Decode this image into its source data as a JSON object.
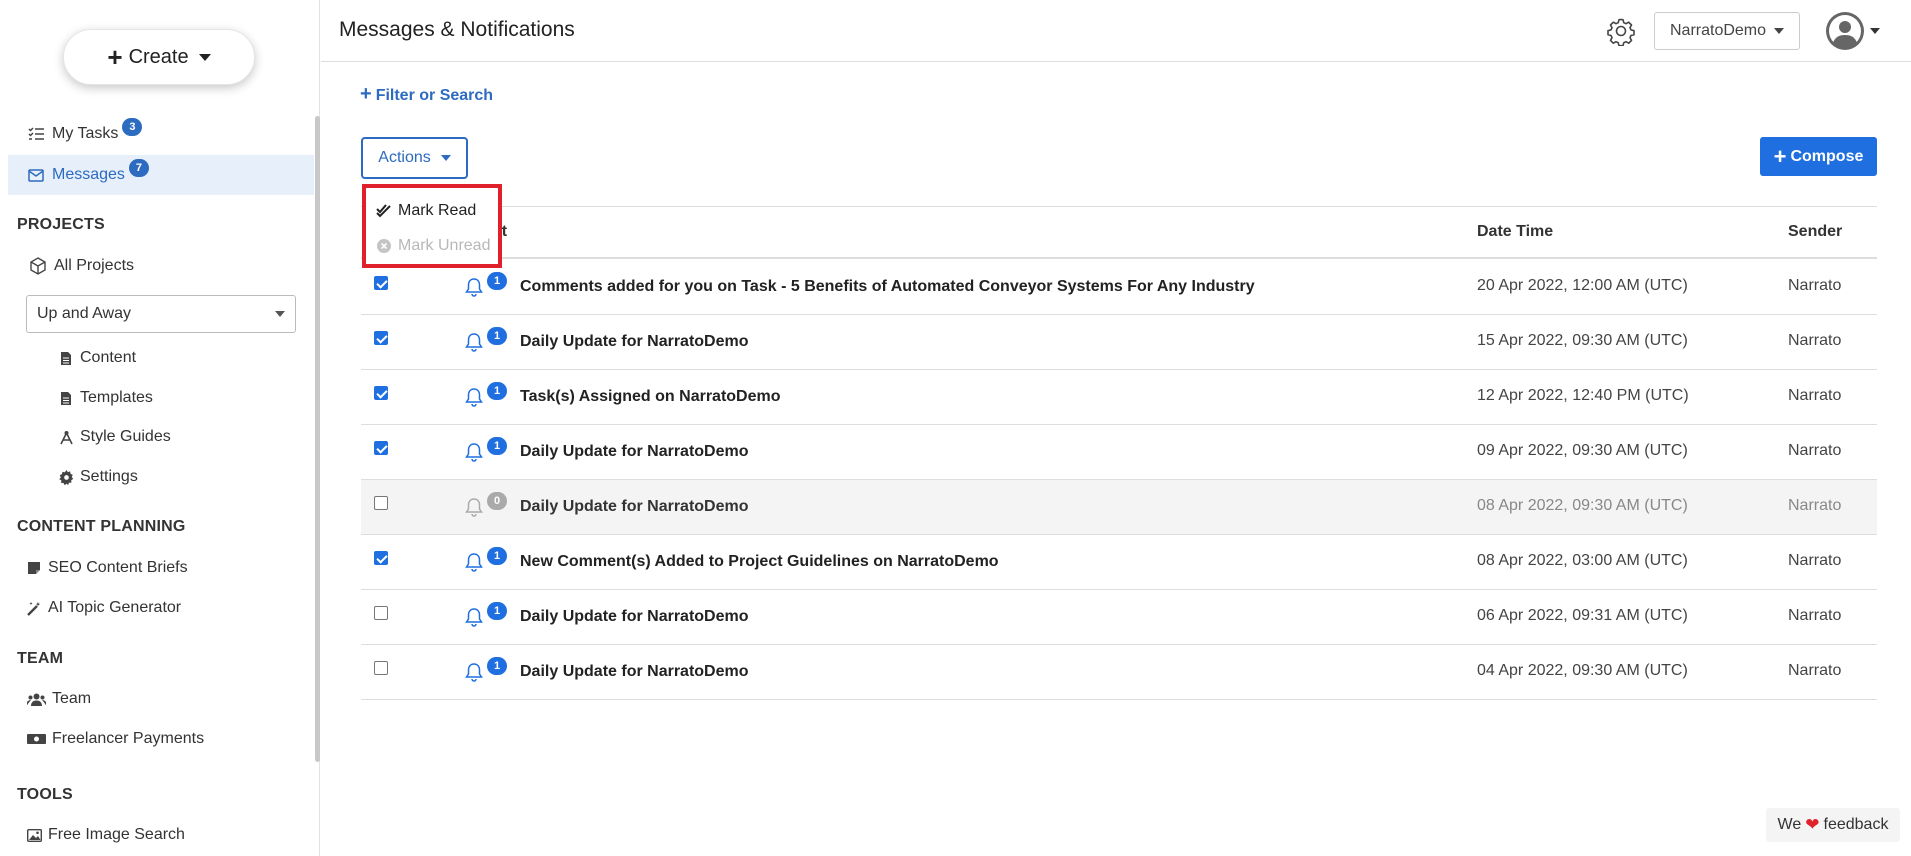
{
  "sidebar": {
    "create_label": "Create",
    "my_tasks": {
      "label": "My Tasks",
      "badge": "3"
    },
    "messages": {
      "label": "Messages",
      "badge": "7"
    },
    "projects_title": "PROJECTS",
    "all_projects": "All Projects",
    "project_select": "Up and Away",
    "project_items": [
      "Content",
      "Templates",
      "Style Guides",
      "Settings"
    ],
    "content_planning_title": "CONTENT PLANNING",
    "seo_briefs": "SEO Content Briefs",
    "ai_topic": "AI Topic Generator",
    "team_title": "TEAM",
    "team": "Team",
    "freelancer": "Freelancer Payments",
    "tools_title": "TOOLS",
    "free_image": "Free Image Search"
  },
  "header": {
    "title": "Messages & Notifications",
    "workspace": "NarratoDemo"
  },
  "main": {
    "filter_label": "Filter or Search",
    "actions_label": "Actions",
    "compose_label": "Compose",
    "menu": {
      "mark_read": "Mark Read",
      "mark_unread": "Mark Unread"
    },
    "columns": {
      "subject": "ect",
      "datetime": "Date Time",
      "sender": "Sender"
    },
    "rows": [
      {
        "checked": true,
        "count": "1",
        "read": false,
        "subject": "Comments added for you on Task - 5 Benefits of Automated Conveyor Systems For Any Industry",
        "datetime": "20 Apr 2022, 12:00 AM (UTC)",
        "sender": "Narrato"
      },
      {
        "checked": true,
        "count": "1",
        "read": false,
        "subject": "Daily Update for NarratoDemo",
        "datetime": "15 Apr 2022, 09:30 AM (UTC)",
        "sender": "Narrato"
      },
      {
        "checked": true,
        "count": "1",
        "read": false,
        "subject": "Task(s) Assigned on NarratoDemo",
        "datetime": "12 Apr 2022, 12:40 PM (UTC)",
        "sender": "Narrato"
      },
      {
        "checked": true,
        "count": "1",
        "read": false,
        "subject": "Daily Update for NarratoDemo",
        "datetime": "09 Apr 2022, 09:30 AM (UTC)",
        "sender": "Narrato"
      },
      {
        "checked": false,
        "count": "0",
        "read": true,
        "subject": "Daily Update for NarratoDemo",
        "datetime": "08 Apr 2022, 09:30 AM (UTC)",
        "sender": "Narrato"
      },
      {
        "checked": true,
        "count": "1",
        "read": false,
        "subject": "New Comment(s) Added to Project Guidelines on NarratoDemo",
        "datetime": "08 Apr 2022, 03:00 AM (UTC)",
        "sender": "Narrato"
      },
      {
        "checked": false,
        "count": "1",
        "read": false,
        "subject": "Daily Update for NarratoDemo",
        "datetime": "06 Apr 2022, 09:31 AM (UTC)",
        "sender": "Narrato"
      },
      {
        "checked": false,
        "count": "1",
        "read": false,
        "subject": "Daily Update for NarratoDemo",
        "datetime": "04 Apr 2022, 09:30 AM (UTC)",
        "sender": "Narrato"
      }
    ]
  },
  "feedback": {
    "before": "We",
    "after": "feedback"
  },
  "colors": {
    "accent": "#1f6fe0",
    "link": "#2c6bc0",
    "highlight": "#e0202a"
  }
}
